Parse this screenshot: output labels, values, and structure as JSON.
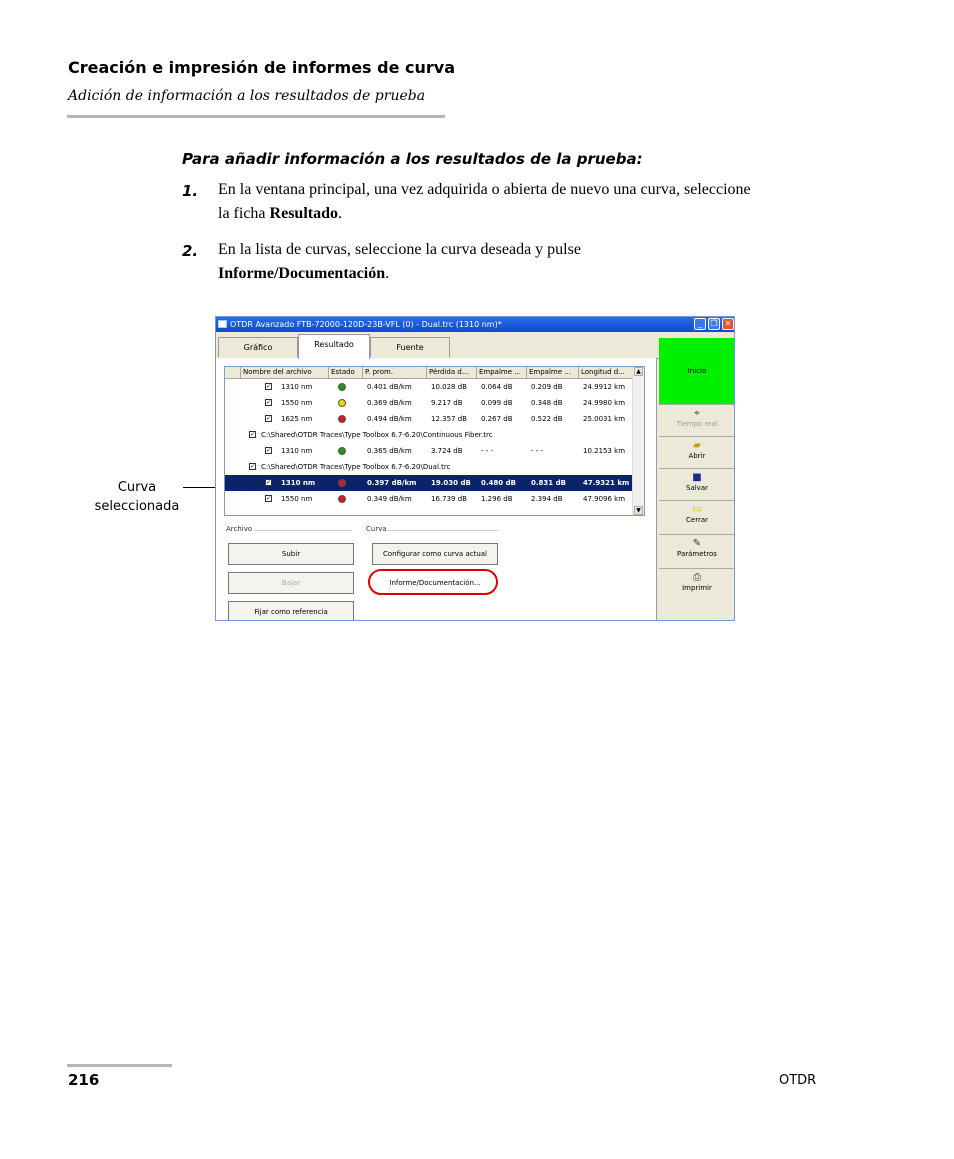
{
  "header": {
    "title": "Creación e impresión de informes de curva",
    "subtitle": "Adición de información a los resultados de prueba"
  },
  "procedure": {
    "title": "Para añadir información a los resultados de la prueba:",
    "steps": [
      {
        "num": "1.",
        "text_before": "En la ventana principal, una vez adquirida o abierta de nuevo una curva, seleccione la ficha ",
        "bold": "Resultado",
        "text_after": "."
      },
      {
        "num": "2.",
        "text_before": "En la lista de curvas, seleccione la curva deseada y pulse ",
        "bold": "Informe/Documentación",
        "text_after": "."
      }
    ]
  },
  "window": {
    "title": "OTDR Avanzado FTB-72000-120D-23B-VFL (0) - Dual.trc (1310 nm)*",
    "tabs": [
      "Gráfico",
      "Resultado",
      "Fuente"
    ],
    "columns": [
      "Nombre del archivo",
      "Estado",
      "P. prom.",
      "Pérdida d...",
      "Empalme ...",
      "Empalme ...",
      "Longitud d..."
    ],
    "rows": [
      {
        "type": "trace",
        "name": "1310 nm",
        "status": "green",
        "p": "0.401 dB/km",
        "loss": "10.028 dB",
        "e1": "0.064 dB",
        "e2": "0.209 dB",
        "len": "24.9912 km"
      },
      {
        "type": "trace",
        "name": "1550 nm",
        "status": "yellow",
        "p": "0.369 dB/km",
        "loss": "9.217 dB",
        "e1": "0.099 dB",
        "e2": "0.348 dB",
        "len": "24.9980 km"
      },
      {
        "type": "trace",
        "name": "1625 nm",
        "status": "red",
        "p": "0.494 dB/km",
        "loss": "12.357 dB",
        "e1": "0.267 dB",
        "e2": "0.522 dB",
        "len": "25.0031 km"
      },
      {
        "type": "file",
        "name": "C:\\Shared\\OTDR Traces\\Type Toolbox 6.7-6.20\\Continuous Fiber.trc"
      },
      {
        "type": "trace",
        "name": "1310 nm",
        "status": "green",
        "p": "0.365 dB/km",
        "loss": "3.724 dB",
        "e1": "- - -",
        "e2": "- - -",
        "len": "10.2153 km"
      },
      {
        "type": "file",
        "name": "C:\\Shared\\OTDR Traces\\Type Toolbox 6.7-6.20\\Dual.trc"
      },
      {
        "type": "trace",
        "selected": true,
        "name": "1310 nm",
        "status": "red",
        "p": "0.397 dB/km",
        "loss": "19.030 dB",
        "e1": "0.480 dB",
        "e2": "0.831 dB",
        "len": "47.9321 km"
      },
      {
        "type": "trace",
        "name": "1550 nm",
        "status": "red",
        "p": "0.349 dB/km",
        "loss": "16.739 dB",
        "e1": "1.296 dB",
        "e2": "2.394 dB",
        "len": "47.9096 km"
      }
    ],
    "sections": {
      "archivo": "Archivo",
      "curva": "Curva"
    },
    "buttons": {
      "subir": "Subir",
      "bajar": "Bajar",
      "fijar": "Fijar como referencia",
      "configurar": "Configurar como curva actual",
      "informe": "Informe/Documentación..."
    },
    "side": {
      "inicio": "Inicio",
      "tiempo_real": "Tiempo real",
      "abrir": "Abrir",
      "salvar": "Salvar",
      "cerrar": "Cerrar",
      "parametros": "Parámetros",
      "imprimir": "Imprimir"
    },
    "status_colors": {
      "green": "#1a9a1a",
      "yellow": "#e8d800",
      "red": "#d81818"
    }
  },
  "callout": {
    "line1": "Curva",
    "line2": "seleccionada"
  },
  "footer": {
    "page": "216",
    "product": "OTDR"
  }
}
